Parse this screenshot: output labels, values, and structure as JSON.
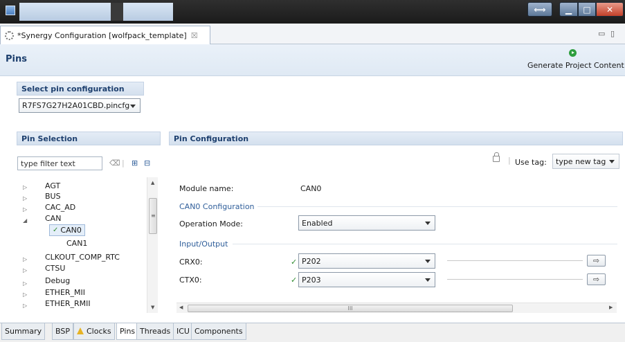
{
  "window": {
    "resize_glyph": "⟺",
    "min_glyph": "▁",
    "max_glyph": "□",
    "close_glyph": "✕"
  },
  "editor_tab": {
    "label": "*Synergy Configuration [wolfpack_template]",
    "close": "☒",
    "minimize": "▭",
    "maximize": "▯"
  },
  "header": {
    "title": "Pins",
    "generate_label": "Generate Project Content"
  },
  "select_pin_config": {
    "heading": "Select pin configuration",
    "value": "R7FS7G27H2A01CBD.pincfg"
  },
  "pin_selection": {
    "heading": "Pin Selection",
    "filter_placeholder": "type filter text",
    "tools": {
      "clear": "⌫",
      "expand": "⊞",
      "collapse": "⊟"
    },
    "items": [
      {
        "label": "AGT",
        "arrow": "▷"
      },
      {
        "label": "BUS",
        "arrow": "▷"
      },
      {
        "label": "CAC_AD",
        "arrow": "▷"
      },
      {
        "label": "CAN",
        "arrow": "◢"
      },
      {
        "label": "CAN0",
        "check": "✓"
      },
      {
        "label": "CAN1"
      },
      {
        "label": "CLKOUT_COMP_RTC",
        "arrow": "▷"
      },
      {
        "label": "CTSU",
        "arrow": "▷"
      },
      {
        "label": "Debug",
        "arrow": "▷"
      },
      {
        "label": "ETHER_MII",
        "arrow": "▷"
      },
      {
        "label": "ETHER_RMII",
        "arrow": "▷"
      }
    ],
    "scroll_up": "▲",
    "scroll_grip": "≡",
    "scroll_down": "▼"
  },
  "pin_config": {
    "heading": "Pin Configuration",
    "use_tag_label": "Use tag:",
    "use_tag_value": "type new tag",
    "module_name_label": "Module name:",
    "module_name_value": "CAN0",
    "config_heading": "CAN0 Configuration",
    "operation_mode_label": "Operation Mode:",
    "operation_mode_value": "Enabled",
    "io_heading": "Input/Output",
    "pins": [
      {
        "label": "CRX0:",
        "value": "P202",
        "check": "✓",
        "goto": "⇨"
      },
      {
        "label": "CTX0:",
        "value": "P203",
        "check": "✓",
        "goto": "⇨"
      }
    ],
    "hscroll_left": "◀",
    "hscroll_grip": "III",
    "hscroll_right": "▶"
  },
  "bottom_tabs": [
    {
      "label": "Summary"
    },
    {
      "label": "BSP"
    },
    {
      "label": "Clocks",
      "warning": true
    },
    {
      "label": "Pins",
      "active": true
    },
    {
      "label": "Threads"
    },
    {
      "label": "ICU"
    },
    {
      "label": "Components"
    }
  ]
}
